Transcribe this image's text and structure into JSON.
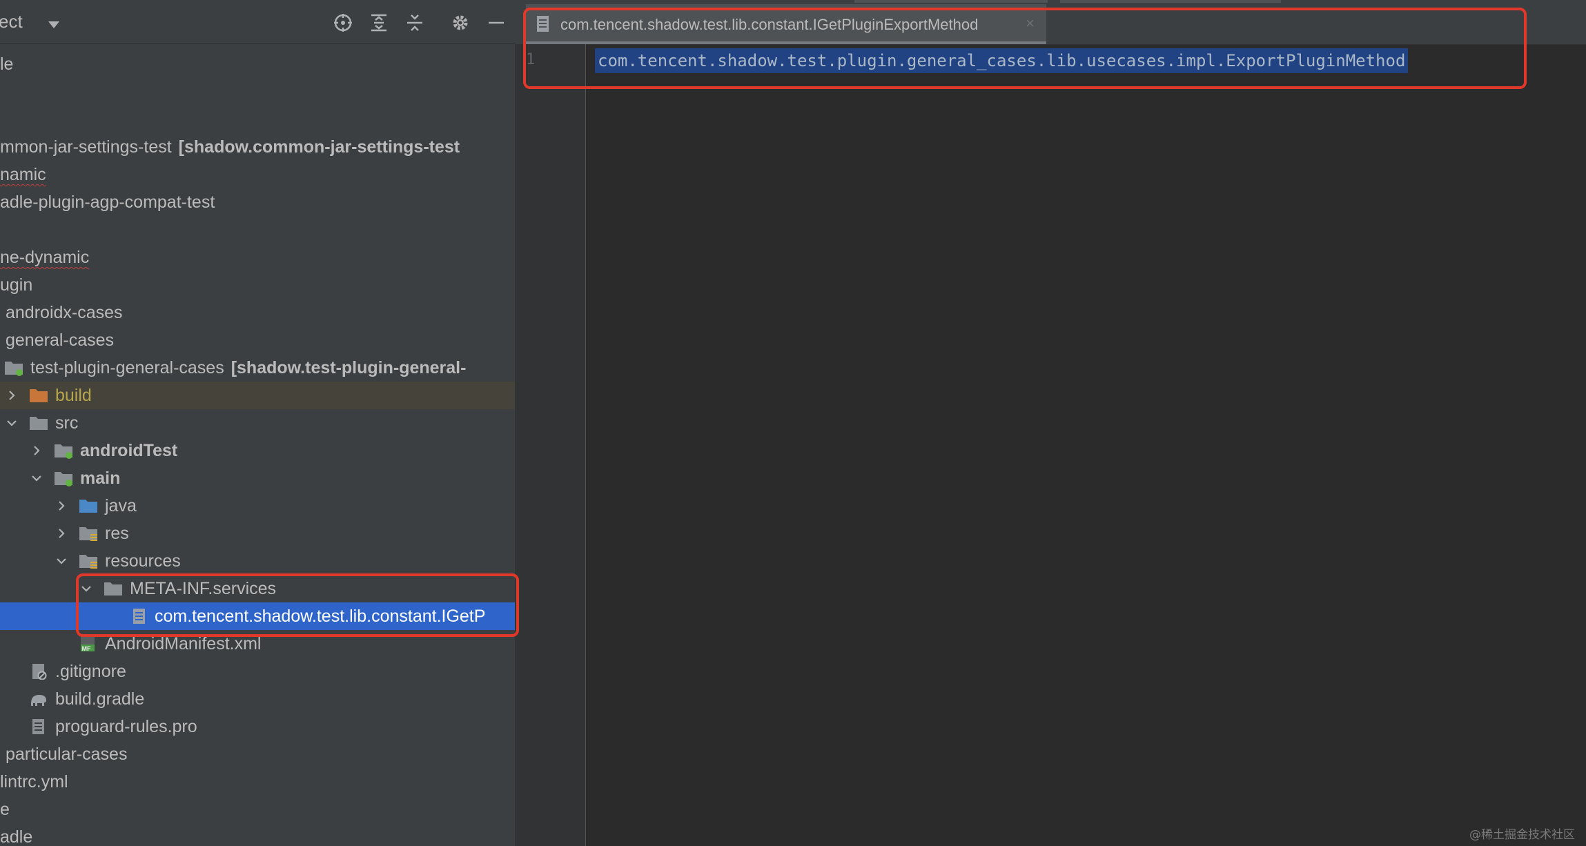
{
  "project_panel": {
    "header_title": "ect",
    "toolbar": {
      "locate": "crosshair-icon",
      "expand_all": "expand-all-icon",
      "collapse_all": "collapse-all-icon",
      "settings": "gear-icon",
      "hide": "minimize-icon"
    },
    "tree": [
      {
        "label": "le"
      },
      {
        "label": "mmon-jar-settings-test",
        "extra": "[shadow.common-jar-settings-test"
      },
      {
        "label": "namic"
      },
      {
        "label": "adle-plugin-agp-compat-test"
      },
      {
        "label": "ne-dynamic"
      },
      {
        "label": "ugin"
      },
      {
        "label": "androidx-cases"
      },
      {
        "label": "general-cases"
      },
      {
        "label": "test-plugin-general-cases",
        "extra": "[shadow.test-plugin-general-"
      },
      {
        "label": "build"
      },
      {
        "label": "src"
      },
      {
        "label": "androidTest"
      },
      {
        "label": "main"
      },
      {
        "label": "java"
      },
      {
        "label": "res"
      },
      {
        "label": "resources"
      },
      {
        "label": "META-INF.services"
      },
      {
        "label": "com.tencent.shadow.test.lib.constant.IGetP"
      },
      {
        "label": "AndroidManifest.xml",
        "badge": "MF"
      },
      {
        "label": ".gitignore"
      },
      {
        "label": "build.gradle"
      },
      {
        "label": "proguard-rules.pro"
      },
      {
        "label": "particular-cases"
      },
      {
        "label": "lintrc.yml"
      },
      {
        "label": "e"
      },
      {
        "label": "adle"
      }
    ]
  },
  "editor": {
    "tab": {
      "label": "com.tencent.shadow.test.lib.constant.IGetPluginExportMethod",
      "close": "×"
    },
    "line_number": "1",
    "code": "com.tencent.shadow.test.plugin.general_cases.lib.usecases.impl.ExportPluginMethod"
  },
  "colors": {
    "panel_bg": "#3c3f41",
    "editor_bg": "#2b2b2b",
    "selection": "#2f65ca",
    "highlight_box": "#e0392b",
    "build_folder_text": "#b8a64c"
  },
  "watermark": "@稀土掘金技术社区"
}
